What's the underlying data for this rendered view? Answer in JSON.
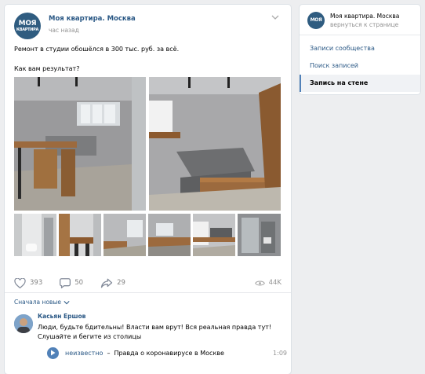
{
  "post": {
    "author": "Моя квартира. Москва",
    "time": "час назад",
    "avatar_line1": "МОЯ",
    "avatar_line2": "КВАРТИРА",
    "text_line1": "Ремонт в студии обошёлся в 300 тыс. руб. за всё.",
    "text_line2": "Как вам результат?",
    "likes": "393",
    "comments": "50",
    "shares": "29",
    "views": "44K"
  },
  "comments_section": {
    "sort_label": "Сначала новые",
    "comment": {
      "author": "Касьян Ершов",
      "text_line1": "Люди, будьте бдительны! Власти вам врут! Вся реальная правда тут!",
      "text_line2": "Слушайте и бегите из столицы",
      "audio_artist": "неизвестно",
      "audio_title": "Правда о коронавирусе в Москве",
      "audio_duration": "1:09"
    }
  },
  "sidebar": {
    "group_name": "Моя квартира. Москва",
    "back_link": "вернуться к странице",
    "items": [
      {
        "label": "Записи сообщества",
        "active": false
      },
      {
        "label": "Поиск записей",
        "active": false
      },
      {
        "label": "Запись на стене",
        "active": true
      }
    ]
  },
  "colors": {
    "link": "#2a5885",
    "accent": "#5181b8",
    "background": "#edeef0"
  }
}
